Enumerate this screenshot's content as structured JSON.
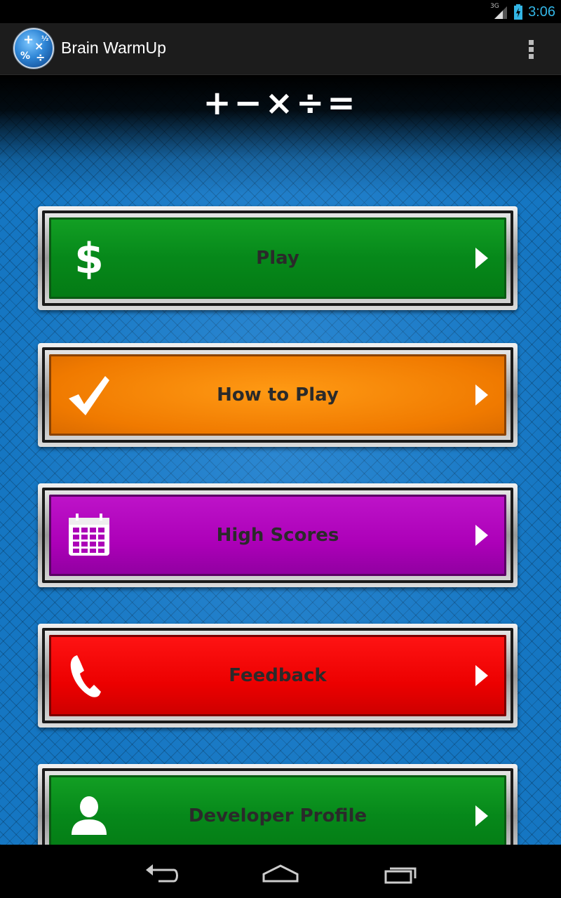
{
  "status_bar": {
    "network": "3G",
    "time": "3:06",
    "icons": [
      "signal-icon",
      "battery-charging-icon"
    ]
  },
  "action_bar": {
    "app_title": "Brain WarmUp",
    "app_icon": "brain-warmup-math-icon",
    "overflow_icon": "overflow-menu-icon"
  },
  "header": {
    "math_symbols": "+−×÷="
  },
  "menu": {
    "buttons": [
      {
        "label": "Play",
        "icon": "dollar-icon",
        "color": "#06881a"
      },
      {
        "label": "How to Play",
        "icon": "checkmark-icon",
        "color": "#f07a00"
      },
      {
        "label": "High Scores",
        "icon": "calendar-icon",
        "color": "#ac00b8"
      },
      {
        "label": "Feedback",
        "icon": "phone-icon",
        "color": "#ec0000"
      },
      {
        "label": "Developer Profile",
        "icon": "person-icon",
        "color": "#06881a"
      }
    ]
  },
  "nav_bar": {
    "icons": [
      "back-icon",
      "home-icon",
      "recent-apps-icon"
    ]
  },
  "colors": {
    "accent": "#33b5e5",
    "background_blue": "#1576c2"
  }
}
